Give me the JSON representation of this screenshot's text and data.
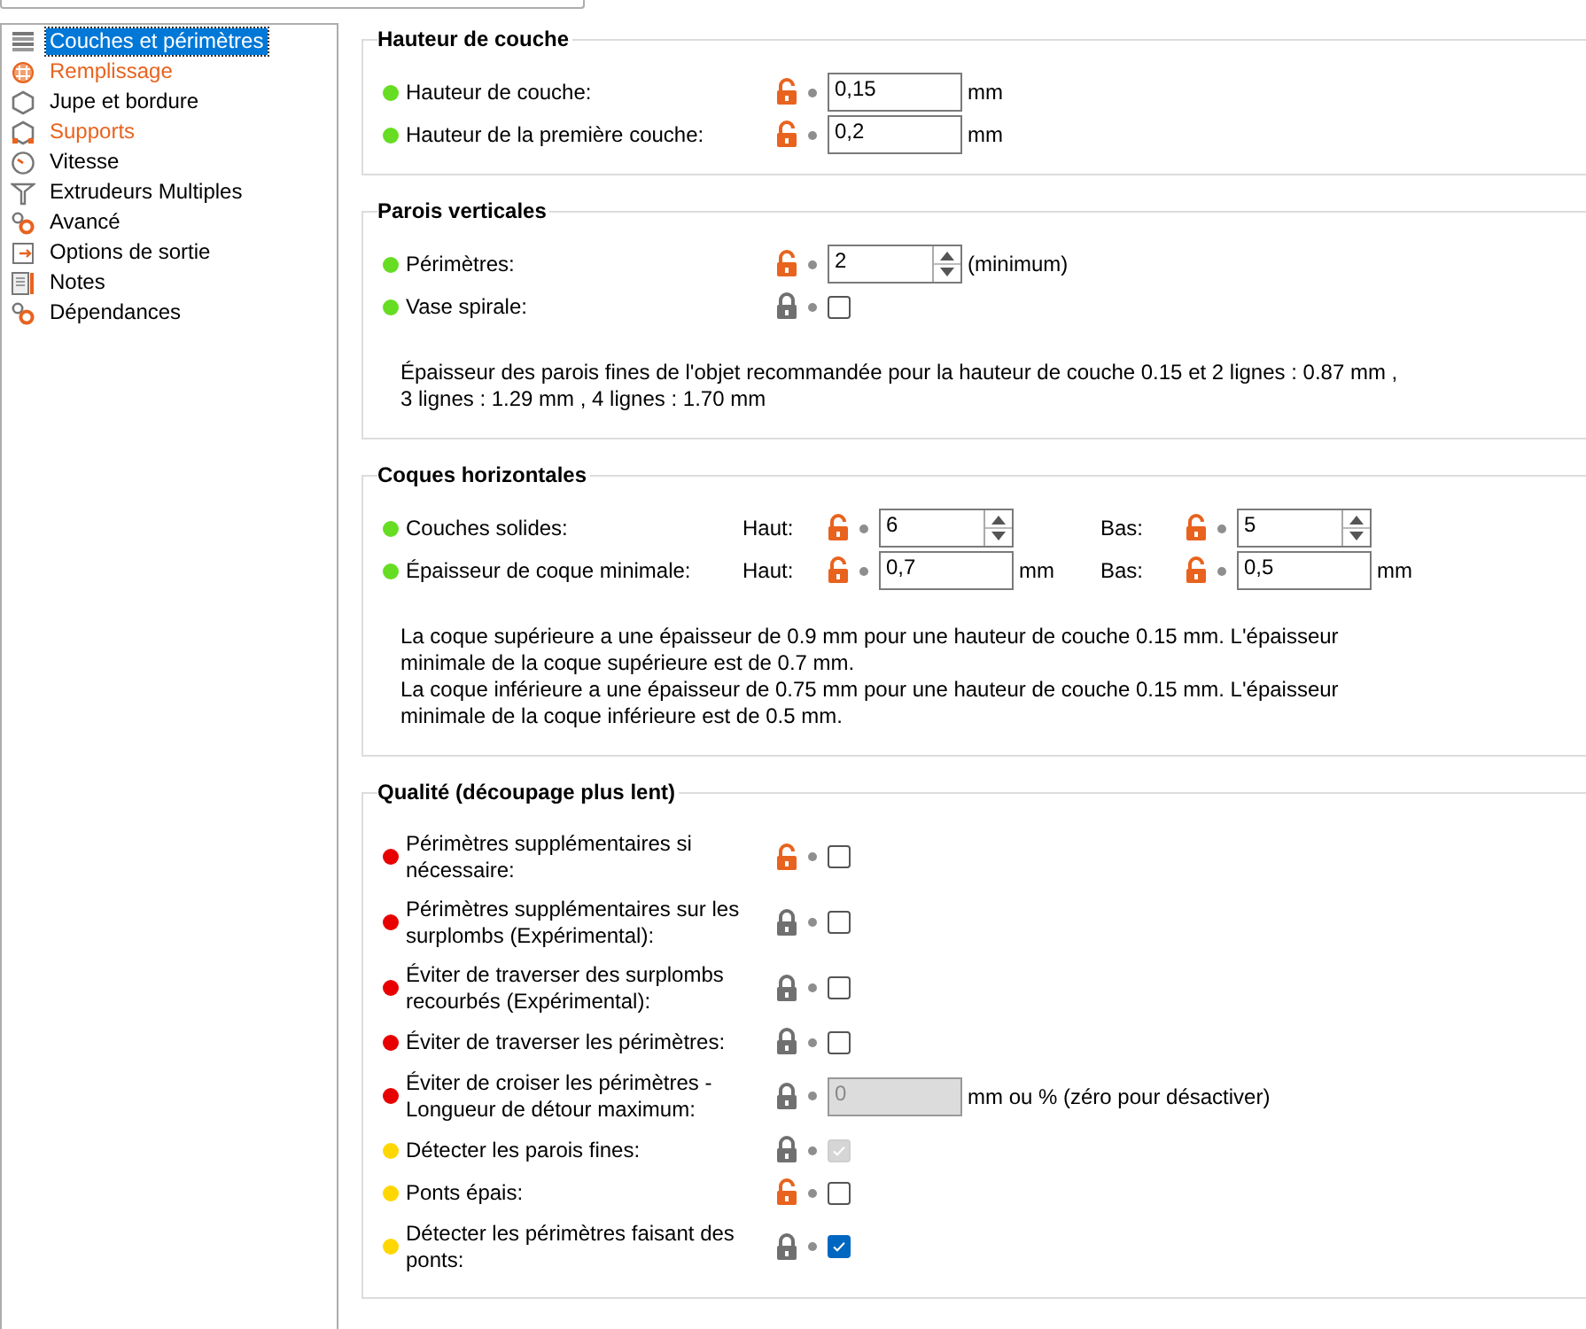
{
  "sidebar": {
    "items": [
      {
        "label": "Couches et périmètres",
        "selected": true,
        "modified": false
      },
      {
        "label": "Remplissage",
        "selected": false,
        "modified": true
      },
      {
        "label": "Jupe et bordure",
        "selected": false,
        "modified": false
      },
      {
        "label": "Supports",
        "selected": false,
        "modified": true
      },
      {
        "label": "Vitesse",
        "selected": false,
        "modified": false
      },
      {
        "label": "Extrudeurs Multiples",
        "selected": false,
        "modified": false
      },
      {
        "label": "Avancé",
        "selected": false,
        "modified": false
      },
      {
        "label": "Options de sortie",
        "selected": false,
        "modified": false
      },
      {
        "label": "Notes",
        "selected": false,
        "modified": false
      },
      {
        "label": "Dépendances",
        "selected": false,
        "modified": false
      }
    ]
  },
  "groups": [
    {
      "title": "Hauteur de couche",
      "rows": [
        {
          "label": "Hauteur de couche:",
          "color": "#66dd22",
          "fields": [
            {
              "locked": false,
              "kind": "text",
              "value": "0,15",
              "unit": "mm"
            }
          ]
        },
        {
          "label": "Hauteur de la première couche:",
          "color": "#66dd22",
          "fields": [
            {
              "locked": false,
              "kind": "text",
              "value": "0,2",
              "unit": "mm"
            }
          ]
        }
      ]
    },
    {
      "title": "Parois verticales",
      "rows": [
        {
          "label": "Périmètres:",
          "color": "#66dd22",
          "fields": [
            {
              "locked": false,
              "kind": "spin",
              "value": "2",
              "unit": "(minimum)"
            }
          ]
        },
        {
          "label": "Vase spirale:",
          "color": "#66dd22",
          "fields": [
            {
              "locked": true,
              "kind": "checkbox",
              "checked": false,
              "disabled": false
            }
          ]
        }
      ],
      "notes": [
        "Épaisseur des parois fines de l'objet recommandée pour la hauteur de couche 0.15 et 2 lignes : 0.87 mm , 3 lignes : 1.29 mm , 4 lignes : 1.70 mm"
      ]
    },
    {
      "title": "Coques horizontales",
      "rows": [
        {
          "label": "Couches solides:",
          "color": "#66dd22",
          "fields": [
            {
              "prefix": "Haut:",
              "locked": false,
              "kind": "spin",
              "value": "6"
            },
            {
              "prefix": "Bas:",
              "locked": false,
              "kind": "spin",
              "value": "5"
            }
          ]
        },
        {
          "label": "Épaisseur de coque minimale:",
          "color": "#66dd22",
          "fields": [
            {
              "prefix": "Haut:",
              "locked": false,
              "kind": "text",
              "value": "0,7",
              "unit": "mm"
            },
            {
              "prefix": "Bas:",
              "locked": false,
              "kind": "text",
              "value": "0,5",
              "unit": "mm"
            }
          ]
        }
      ],
      "notes": [
        "La coque supérieure a une épaisseur de 0.9 mm pour une hauteur de couche 0.15 mm. L'épaisseur minimale de la coque supérieure est de 0.7 mm.",
        "La coque inférieure a une épaisseur de 0.75 mm pour une hauteur de couche 0.15 mm. L'épaisseur minimale de la coque inférieure est de 0.5 mm."
      ]
    },
    {
      "title": "Qualité (découpage plus lent)",
      "rows": [
        {
          "label": "Périmètres supplémentaires si nécessaire:",
          "color": "#e80000",
          "fields": [
            {
              "locked": false,
              "kind": "checkbox",
              "checked": false,
              "disabled": false
            }
          ]
        },
        {
          "label": "Périmètres supplémentaires sur les surplombs (Expérimental):",
          "color": "#e80000",
          "fields": [
            {
              "locked": true,
              "kind": "checkbox",
              "checked": false,
              "disabled": false
            }
          ]
        },
        {
          "label": "Éviter de traverser des surplombs recourbés (Expérimental):",
          "color": "#e80000",
          "fields": [
            {
              "locked": true,
              "kind": "checkbox",
              "checked": false,
              "disabled": false
            }
          ]
        },
        {
          "label": "Éviter de traverser les périmètres:",
          "color": "#e80000",
          "fields": [
            {
              "locked": true,
              "kind": "checkbox",
              "checked": false,
              "disabled": false
            }
          ]
        },
        {
          "label": "Éviter de croiser les périmètres - Longueur de détour maximum:",
          "color": "#e80000",
          "fields": [
            {
              "locked": true,
              "kind": "text",
              "value": "0",
              "disabled": true,
              "unit": "mm ou % (zéro pour désactiver)"
            }
          ]
        },
        {
          "label": "Détecter les parois fines:",
          "color": "#ffd700",
          "fields": [
            {
              "locked": true,
              "kind": "checkbox",
              "checked": true,
              "disabled": true
            }
          ]
        },
        {
          "label": "Ponts épais:",
          "color": "#ffd700",
          "fields": [
            {
              "locked": false,
              "kind": "checkbox",
              "checked": false,
              "disabled": false
            }
          ]
        },
        {
          "label": "Détecter les périmètres faisant des ponts:",
          "color": "#ffd700",
          "fields": [
            {
              "locked": true,
              "kind": "checkbox",
              "checked": true,
              "disabled": false
            }
          ]
        }
      ]
    }
  ]
}
